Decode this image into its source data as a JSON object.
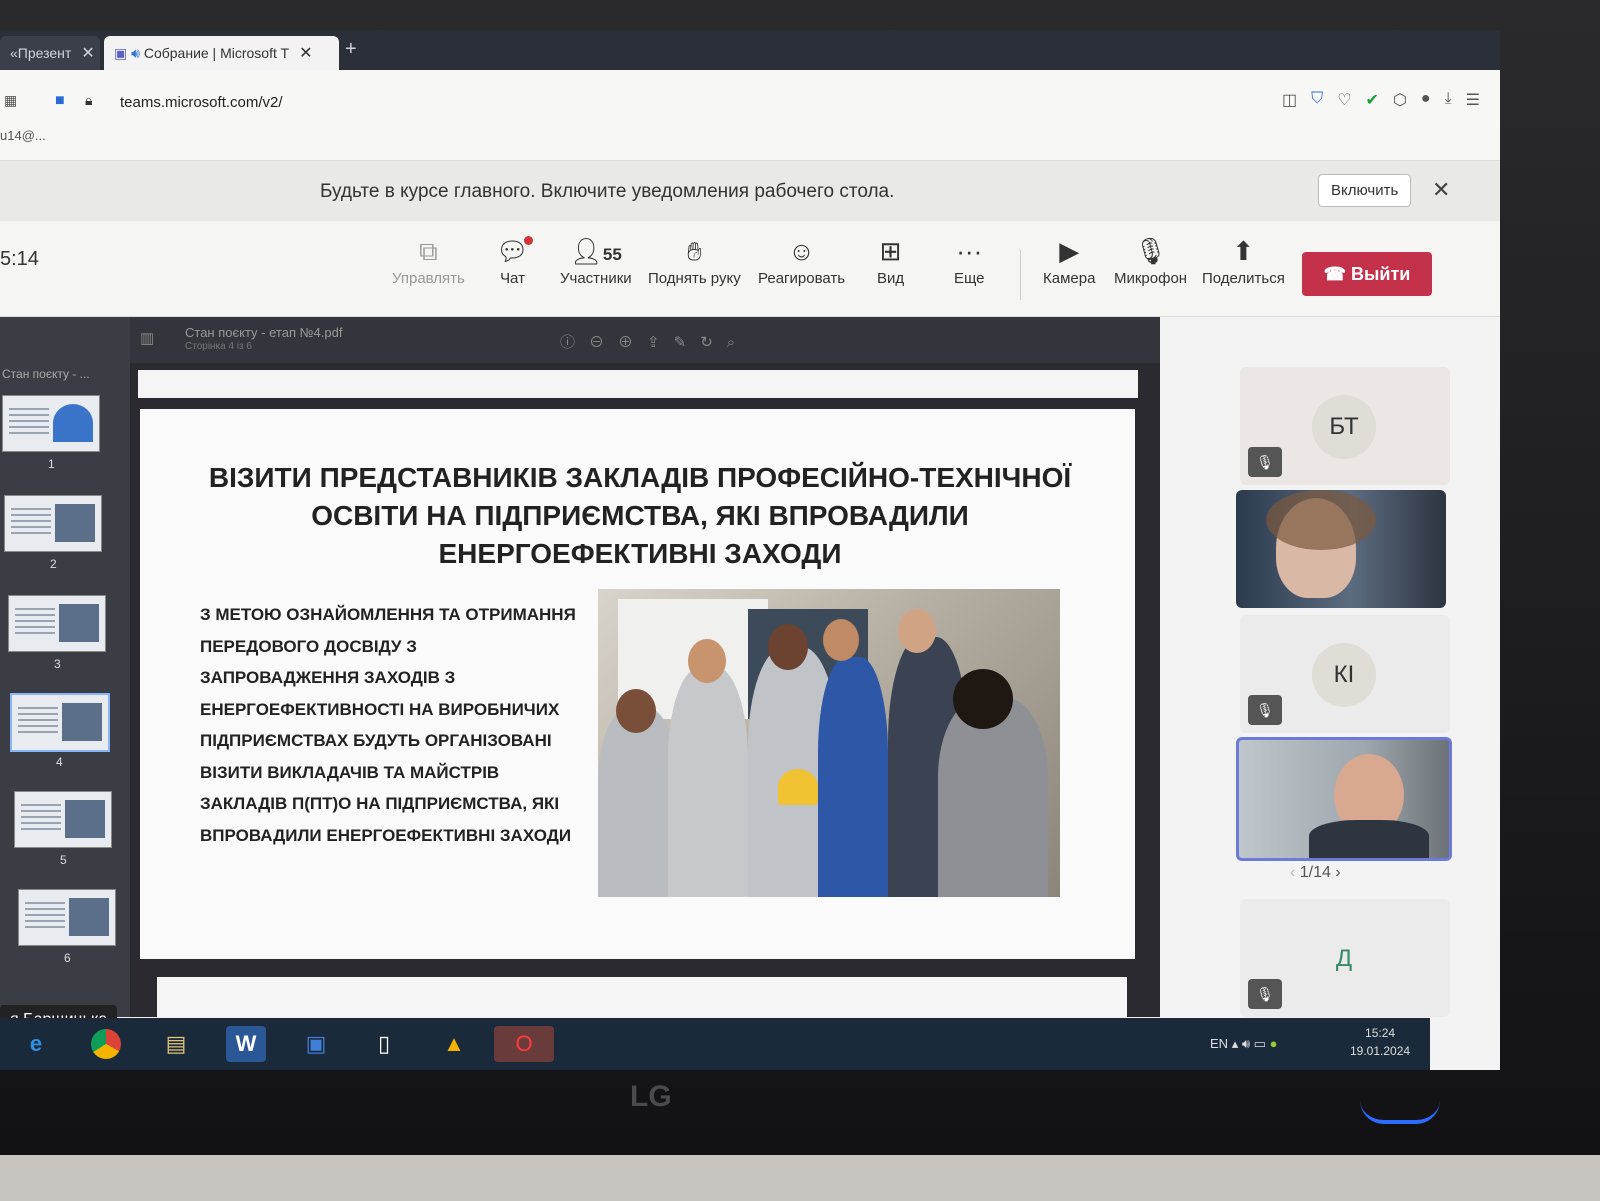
{
  "browser": {
    "tabs": [
      {
        "label": "«Презент",
        "active": false
      },
      {
        "label": "Собрание | Microsoft T",
        "active": true
      }
    ],
    "new_tab": "+",
    "url": "teams.microsoft.com/v2/",
    "account": "u14@...",
    "window_buttons": {
      "min": "▁",
      "max": "▢",
      "close": "✕"
    }
  },
  "notification": {
    "message": "Будьте в курсе главного. Включите уведомления рабочего стола.",
    "button": "Включить",
    "close": "✕"
  },
  "toolbar": {
    "timer": "5:14",
    "items": [
      {
        "label": "Управлять",
        "icon": "share-screen-icon"
      },
      {
        "label": "Чат",
        "icon": "chat-icon"
      },
      {
        "label": "Участники",
        "icon": "people-icon",
        "count": "55"
      },
      {
        "label": "Поднять руку",
        "icon": "hand-icon"
      },
      {
        "label": "Реагировать",
        "icon": "emoji-icon"
      },
      {
        "label": "Вид",
        "icon": "grid-view-icon"
      },
      {
        "label": "Еще",
        "icon": "more-icon"
      },
      {
        "label": "Камера",
        "icon": "camera-off-icon"
      },
      {
        "label": "Микрофон",
        "icon": "mic-off-icon"
      },
      {
        "label": "Поделиться",
        "icon": "share-icon"
      }
    ],
    "leave_label": "Выйти",
    "more_glyph": "···"
  },
  "pdf": {
    "filename": "Стан поєкту - етап №4.pdf",
    "page_info": "Сторінка 4 із 6",
    "thumbs_title": "Стан поєкту - ...",
    "thumb_numbers": [
      "1",
      "2",
      "3",
      "4",
      "5",
      "6"
    ]
  },
  "slide": {
    "title": "ВІЗИТИ ПРЕДСТАВНИКІВ ЗАКЛАДІВ ПРОФЕСІЙНО-ТЕХНІЧНОЇ ОСВІТИ НА  ПІДПРИЄМСТВА, ЯКІ ВПРОВАДИЛИ ЕНЕРГОЕФЕКТИВНІ ЗАХОДИ",
    "body": "З МЕТОЮ ОЗНАЙОМЛЕННЯ ТА ОТРИМАННЯ ПЕРЕДОВОГО ДОСВІДУ З ЗАПРОВАДЖЕННЯ ЗАХОДІВ З ЕНЕРГОЕФЕКТИВНОСТІ НА ВИРОБНИЧИХ ПІДПРИЄМСТВАХ БУДУТЬ ОРГАНІЗОВАНІ ВІЗИТИ ВИКЛАДАЧІВ ТА МАЙСТРІВ ЗАКЛАДІВ П(ПТ)О НА  ПІДПРИЄМСТВА, ЯКІ ВПРОВАДИЛИ ЕНЕРГОЕФЕКТИВНІ ЗАХОДИ"
  },
  "participants": {
    "tiles": [
      {
        "initials": "БТ"
      },
      {
        "initials": "КІ"
      },
      {
        "initials": "Д"
      }
    ],
    "pager": "1/14",
    "presenter_name": "я Барщицька"
  },
  "taskbar": {
    "lang": "EN",
    "time": "15:24",
    "date": "19.01.2024"
  },
  "monitor": {
    "brand": "LG"
  },
  "colors": {
    "leave": "#c4314b",
    "accent": "#2b6cd4"
  }
}
